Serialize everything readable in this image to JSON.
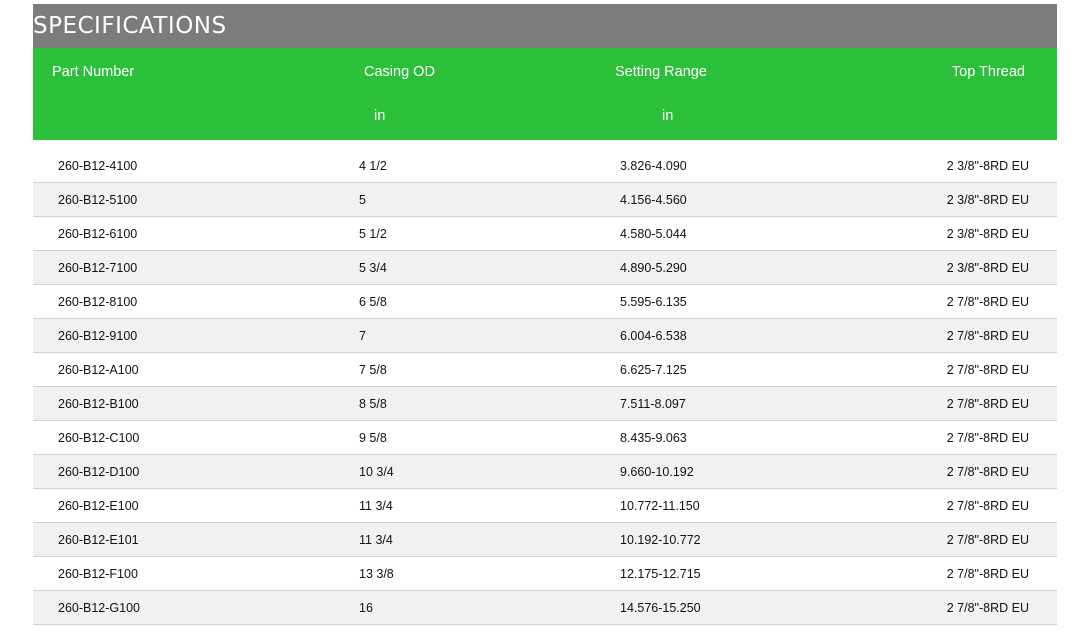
{
  "section": {
    "title": "SPECIFICATIONS"
  },
  "colors": {
    "title_bg": "#7c7c7c",
    "header_bg": "#2cc03a",
    "row_alt_bg": "#f1f1f1"
  },
  "table": {
    "headers": [
      "Part Number",
      "Casing OD",
      "Setting Range",
      "Top Thread"
    ],
    "units": [
      "",
      "in",
      "in",
      ""
    ],
    "rows": [
      [
        "260-B12-4100",
        "4 1/2",
        "3.826-4.090",
        "2 3/8\"-8RD EU"
      ],
      [
        "260-B12-5100",
        "5",
        "4.156-4.560",
        "2 3/8\"-8RD EU"
      ],
      [
        "260-B12-6100",
        "5 1/2",
        "4.580-5.044",
        "2 3/8\"-8RD EU"
      ],
      [
        "260-B12-7100",
        "5 3/4",
        "4.890-5.290",
        "2 3/8\"-8RD EU"
      ],
      [
        "260-B12-8100",
        "6 5/8",
        "5.595-6.135",
        "2 7/8\"-8RD EU"
      ],
      [
        "260-B12-9100",
        "7",
        "6.004-6.538",
        "2 7/8\"-8RD EU"
      ],
      [
        "260-B12-A100",
        "7 5/8",
        "6.625-7.125",
        "2 7/8\"-8RD EU"
      ],
      [
        "260-B12-B100",
        "8 5/8",
        "7.511-8.097",
        "2 7/8\"-8RD EU"
      ],
      [
        "260-B12-C100",
        "9 5/8",
        "8.435-9.063",
        "2 7/8\"-8RD EU"
      ],
      [
        "260-B12-D100",
        "10 3/4",
        "9.660-10.192",
        "2 7/8\"-8RD EU"
      ],
      [
        "260-B12-E100",
        "11 3/4",
        "10.772-11.150",
        "2 7/8\"-8RD EU"
      ],
      [
        "260-B12-E101",
        "11 3/4",
        "10.192-10.772",
        "2 7/8\"-8RD EU"
      ],
      [
        "260-B12-F100",
        "13 3/8",
        "12.175-12.715",
        "2 7/8\"-8RD EU"
      ],
      [
        "260-B12-G100",
        "16",
        "14.576-15.250",
        "2 7/8\"-8RD EU"
      ]
    ]
  }
}
